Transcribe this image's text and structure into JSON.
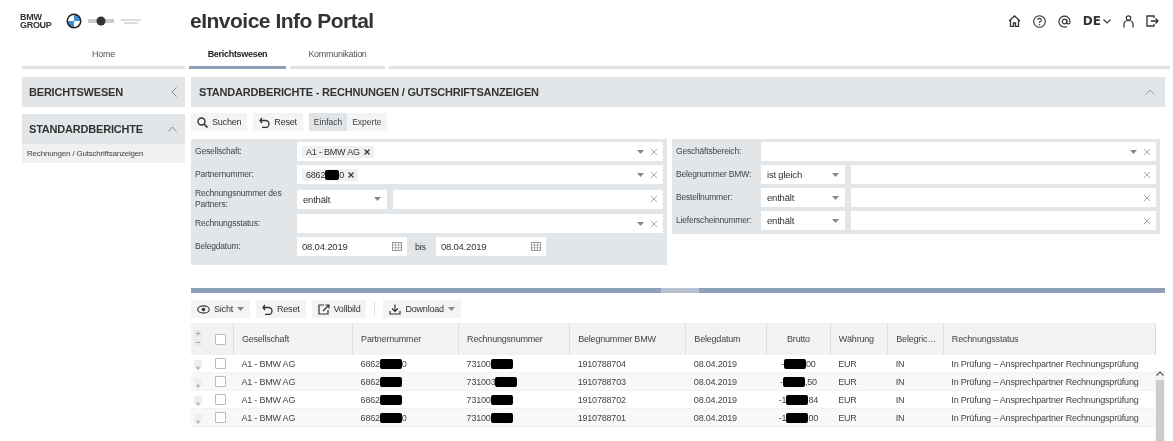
{
  "header": {
    "logo_lines": [
      "BMW",
      "GROUP"
    ],
    "title": "eInvoice Info Portal",
    "language": "DE"
  },
  "nav_tabs": [
    {
      "label": "Home",
      "selected": false
    },
    {
      "label": "Berichtswesen",
      "selected": true
    },
    {
      "label": "Kommunikation",
      "selected": false
    }
  ],
  "sidebar": {
    "sections": [
      {
        "title": "BERICHTSWESEN",
        "expanded": false
      },
      {
        "title": "STANDARDBERICHTE",
        "expanded": true,
        "items": [
          "Rechnungen / Gutschriftsanzeigen"
        ]
      }
    ]
  },
  "report": {
    "title": "STANDARDBERICHTE - RECHNUNGEN / GUTSCHRIFTSANZEIGEN",
    "expanded": true,
    "actions": [
      {
        "label": "Suchen"
      },
      {
        "label": "Reset"
      }
    ],
    "modes": [
      {
        "label": "Einfach",
        "selected": true
      },
      {
        "label": "Experte",
        "selected": false
      }
    ],
    "filters_left": [
      {
        "label": "Gesellschaft:",
        "kind": "multiselect",
        "tokens": [
          "A1 - BMW AG"
        ]
      },
      {
        "label": "Partnernummer:",
        "kind": "multiselect",
        "tokens": [
          {
            "before": "6862",
            "after": "0"
          }
        ]
      },
      {
        "label": "Rechnungsnummer des Partners:",
        "kind": "operator",
        "operator": "enthält"
      },
      {
        "label": "Rechnungsstatus:",
        "kind": "select"
      },
      {
        "label": "Belegdatum:",
        "kind": "daterange",
        "from": "08.04.2019",
        "joiner": "bis",
        "to": "08.04.2019"
      }
    ],
    "filters_right": [
      {
        "label": "Geschäftsbereich:",
        "kind": "select"
      },
      {
        "label": "Belegnummer BMW:",
        "kind": "operator",
        "operator": "ist gleich"
      },
      {
        "label": "Bestellnummer:",
        "kind": "operator",
        "operator": "enthält"
      },
      {
        "label": "Lieferscheinnummer:",
        "kind": "operator",
        "operator": "enthält"
      }
    ]
  },
  "grid": {
    "select_all_checked": false,
    "tools": [
      {
        "label": "Sicht",
        "menu": true
      },
      {
        "label": "Reset",
        "menu": false
      },
      {
        "label": "Vollbild",
        "menu": false
      },
      {
        "label": "Download",
        "menu": true
      }
    ],
    "columns": [
      "Gesellschaft",
      "Partnernummer",
      "Rechnungsnummer",
      "Belegnummer BMW",
      "Belegdatum",
      "Brutto",
      "Währung",
      "Belegric…",
      "Rechnungsstatus"
    ],
    "rows": [
      {
        "expanded": false,
        "checked": false,
        "cells": [
          "A1 - BMW AG",
          {
            "before": "6862",
            "after": "0"
          },
          {
            "before": "73100"
          },
          "1910788704",
          "08.04.2019",
          {
            "before": "-",
            "after": "00"
          },
          "EUR",
          "IN",
          "In Prüfung – Ansprechpartner Rechnungsprüfung"
        ]
      },
      {
        "expanded": false,
        "checked": false,
        "cells": [
          "A1 - BMW AG",
          {
            "before": "6862"
          },
          {
            "before": "731003"
          },
          "1910788703",
          "08.04.2019",
          {
            "before": "-",
            "after": ",50"
          },
          "EUR",
          "IN",
          "In Prüfung – Ansprechpartner Rechnungsprüfung"
        ]
      },
      {
        "expanded": false,
        "checked": false,
        "cells": [
          "A1 - BMW AG",
          {
            "before": "6862"
          },
          {
            "before": "73100"
          },
          "1910788702",
          "08.04.2019",
          {
            "before": "-1",
            "after": "84"
          },
          "EUR",
          "IN",
          "In Prüfung – Ansprechpartner Rechnungsprüfung"
        ]
      },
      {
        "expanded": false,
        "checked": false,
        "cells": [
          "A1 - BMW AG",
          {
            "before": "6862",
            "after": "0"
          },
          {
            "before": "73100"
          },
          "1910788701",
          "08.04.2019",
          {
            "before": "-1",
            "after": "00"
          },
          "EUR",
          "IN",
          "In Prüfung – Ansprechpartner Rechnungsprüfung"
        ]
      }
    ]
  }
}
